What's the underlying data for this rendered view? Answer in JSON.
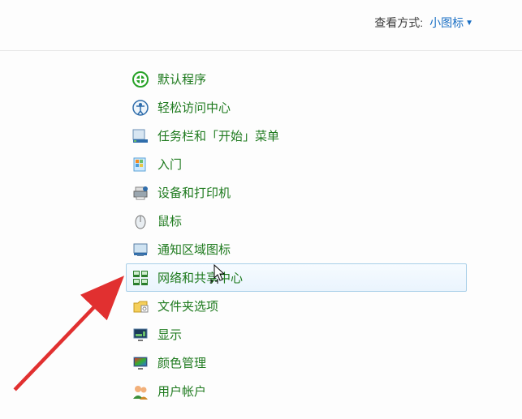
{
  "toolbar": {
    "view_label": "查看方式:",
    "view_mode": "小图标"
  },
  "items": [
    {
      "name": "default-programs",
      "label": "默认程序"
    },
    {
      "name": "ease-of-access",
      "label": "轻松访问中心"
    },
    {
      "name": "taskbar-startmenu",
      "label": "任务栏和「开始」菜单"
    },
    {
      "name": "getting-started",
      "label": "入门"
    },
    {
      "name": "devices-printers",
      "label": "设备和打印机"
    },
    {
      "name": "mouse",
      "label": "鼠标"
    },
    {
      "name": "notification-icons",
      "label": "通知区域图标"
    },
    {
      "name": "network-sharing",
      "label": "网络和共享中心"
    },
    {
      "name": "folder-options",
      "label": "文件夹选项"
    },
    {
      "name": "display",
      "label": "显示"
    },
    {
      "name": "color-management",
      "label": "颜色管理"
    },
    {
      "name": "user-accounts",
      "label": "用户帐户"
    }
  ],
  "hovered_index": 7
}
